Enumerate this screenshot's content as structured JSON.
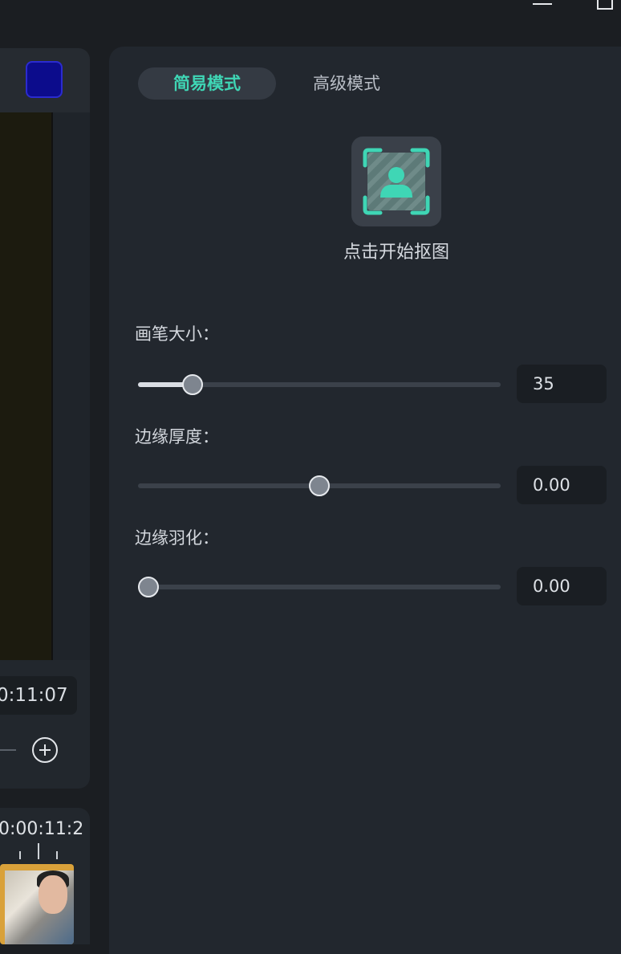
{
  "window": {
    "minimize_icon": "minimize-icon",
    "maximize_icon": "maximize-icon"
  },
  "left_panel": {
    "color_swatch": "#0c0c8c",
    "timecode": "0:11:07",
    "zoom_in_icon": "plus-circle-icon",
    "timeline_time": "0:00:11:2"
  },
  "tabs": [
    {
      "label": "简易模式",
      "active": true
    },
    {
      "label": "高级模式",
      "active": false
    }
  ],
  "cutout": {
    "icon": "person-frame-icon",
    "label": "点击开始抠图"
  },
  "params": [
    {
      "label": "画笔大小：",
      "value": "35",
      "level": 0.13
    },
    {
      "label": "边缘厚度：",
      "value": "0.00",
      "level": 0.5
    },
    {
      "label": "边缘羽化：",
      "value": "0.00",
      "level": 0.0
    }
  ],
  "colors": {
    "accent": "#3fd6b5",
    "panel": "#22272e",
    "background": "#1b1e22"
  }
}
